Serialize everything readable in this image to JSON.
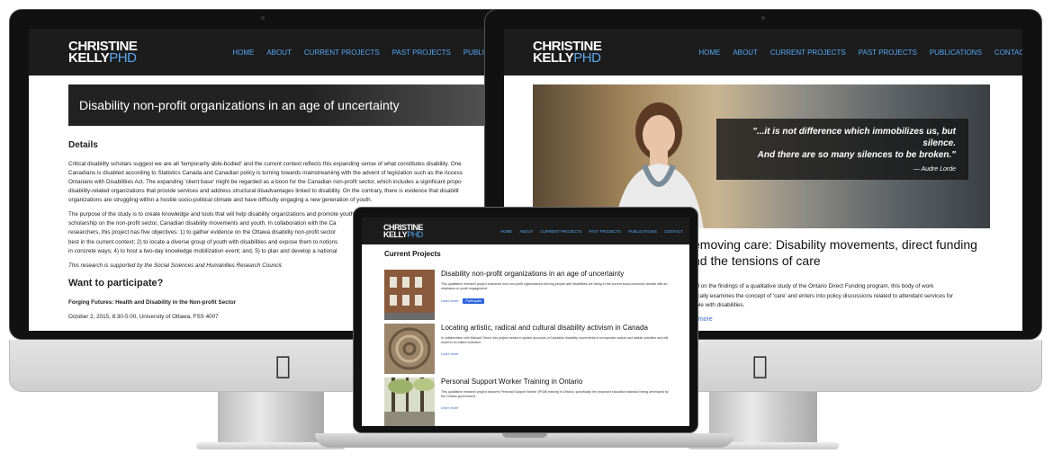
{
  "brand": {
    "line1": "CHRISTINE",
    "line2": "KELLY",
    "suffix": "PHD"
  },
  "nav": [
    "HOME",
    "ABOUT",
    "CURRENT PROJECTS",
    "PAST PROJECTS",
    "PUBLICATIONS",
    "CONTACT"
  ],
  "colors": {
    "header_bg": "#1c1c1c",
    "nav_link": "#56a7f4",
    "button": "#2b63d9"
  },
  "left_page": {
    "hero_title": "Disability non-profit organizations in an age of uncertainty",
    "details_heading": "Details",
    "paragraph1": [
      "Critical disability scholars suggest we are all 'temporarily able-bodied' and the current context reflects this expanding sense of what constitutes disability. One",
      "Canadians is disabled according to Statistics Canada and Canadian policy is turning towards mainstreaming with the advent of legislation such as the Access",
      "Ontarians with Disabilities Act. The expanding 'client base' might be regarded as a boon for the Canadian non-profit sector, which includes a significant propo",
      "disability-related organizations that provide services and address structural disadvantages linked to disability. On the contrary, there is evidence that disabilit",
      "organizations are struggling within a hostile socio-political climate and have difficulty engaging a new generation of youth."
    ],
    "paragraph2": [
      "The purpose of the study is to create knowledge and tools that will help disability organizations and promote youth engagement while contributing to academ",
      "scholarship on the non-profit sector, Canadian disability movements and youth. In collaboration with the Ca",
      "researchers, this project has five objectives: 1) to gather evidence on the Ottawa disability non-profit sector",
      "best in the current context; 2) to locate a diverse group of youth with disabilities and expose them to notions",
      "in concrete ways; 4) to host a two-day knowledge mobilization event; and, 5) to plan and develop a national"
    ],
    "funding_note": "This research is supported by the Social Sciences and Humanities Research Council.",
    "participate_heading": "Want to participate?",
    "event_title": "Forging Futures: Health and Disability in the Non-profit Sector",
    "event_date": "October 2, 2015, 8:30-5:00, University of Ottawa, FSS 4007"
  },
  "right_page": {
    "quote_line1": "\"...it is not difference which immobilizes us, but silence.",
    "quote_line2": "And there are so many silences to be broken.\"",
    "quote_author": "— Audre Lorde",
    "title_line1": "emoving care: Disability movements, direct funding",
    "title_line2": "nd the tensions of care",
    "text_line1": "ed on the findings of a qualitative study of the Ontario Direct Funding program, this body of work",
    "text_line2": "itically examines the concept of 'care' and enters into policy discussions related to attendant services for",
    "text_line3": "ople with disabilities.",
    "more_link": "n more"
  },
  "laptop_page": {
    "heading": "Current Projects",
    "projects": [
      {
        "title": "Disability non-profit organizations in an age of uncertainty",
        "desc": "This qualitative research project examines how non-profit organizations serving people with disabilities are faring in the current socio-economic climate with an emphasis on youth engagement.",
        "learn": "Learn more",
        "button": "Participate"
      },
      {
        "title": "Locating artistic, radical and cultural disability activism in Canada",
        "desc": "In collaboration with Michael Orsini, this project seeks to update accounts of Canadian disability movements to incorporate radical and artistic activities and will result in an edited collection.",
        "learn": "Learn more"
      },
      {
        "title": "Personal Support Worker Training in Ontario",
        "desc": "This qualitative research project explores Personal Support Worker (PSW) training in Ontario, specifically the proposed education standard being developed by the Ontario government.",
        "learn": "Learn more"
      }
    ]
  },
  "device_logos": {
    "apple": ""
  }
}
